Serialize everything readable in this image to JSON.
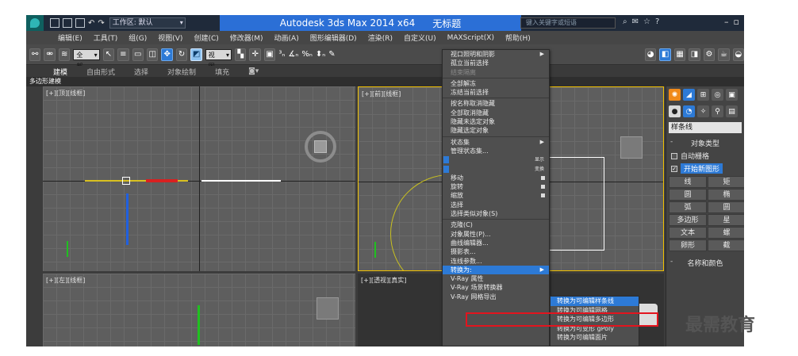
{
  "titlebar": {
    "workspace": "工作区: 默认",
    "app_title": "Autodesk 3ds Max  2014 x64",
    "doc_title": "无标题",
    "search_placeholder": "键入关键字或短语"
  },
  "menubar": [
    "编辑(E)",
    "工具(T)",
    "组(G)",
    "视图(V)",
    "创建(C)",
    "修改器(M)",
    "动画(A)",
    "图形编辑器(D)",
    "渲染(R)",
    "自定义(U)",
    "MAXScript(X)",
    "帮助(H)"
  ],
  "toolbar": {
    "selection_filter": "全部",
    "ref_coord": "视图"
  },
  "ribbon": {
    "tabs": [
      "建模",
      "自由形式",
      "选择",
      "对象绘制",
      "填充"
    ],
    "sub_label": "多边形建模"
  },
  "viewports": {
    "top_left": "[+][顶][线框]",
    "top_right": "[+][前][线框]",
    "bottom_left": "[+][左][线框]",
    "bottom_right": "[+][透视][真实]"
  },
  "quad_menu": {
    "items": [
      {
        "label": "视口照明和阴影",
        "arrow": true
      },
      {
        "label": "孤立当前选择"
      },
      {
        "label": "结束隔离",
        "disabled": true
      },
      {
        "sep": true
      },
      {
        "label": "全部解冻"
      },
      {
        "label": "冻结当前选择"
      },
      {
        "sep": true
      },
      {
        "label": "按名称取消隐藏"
      },
      {
        "label": "全部取消隐藏"
      },
      {
        "label": "隐藏未选定对象"
      },
      {
        "label": "隐藏选定对象"
      },
      {
        "sep": true
      },
      {
        "label": "状态集",
        "arrow": true
      },
      {
        "label": "管理状态集..."
      },
      {
        "label": "显示",
        "right": true
      },
      {
        "label": "变换",
        "right": true
      },
      {
        "label": "移动",
        "sq": true
      },
      {
        "label": "旋转",
        "sq": true
      },
      {
        "label": "缩放",
        "sq": true
      },
      {
        "label": "选择"
      },
      {
        "label": "选择类似对象(S)"
      },
      {
        "sep": true
      },
      {
        "label": "克隆(C)"
      },
      {
        "label": "对象属性(P)..."
      },
      {
        "label": "曲线编辑器..."
      },
      {
        "label": "摄影表..."
      },
      {
        "label": "连线参数..."
      },
      {
        "label": "转换为:",
        "arrow": true,
        "active": true
      },
      {
        "label": "V-Ray 属性"
      },
      {
        "label": "V-Ray 场景转换器"
      },
      {
        "label": "V-Ray 网格导出"
      }
    ]
  },
  "submenu": {
    "items": [
      {
        "label": "转换为可编辑样条线",
        "active": true
      },
      {
        "label": "转换为可编辑网格"
      },
      {
        "label": "转换为可编辑多边形"
      },
      {
        "label": "转换为可变形 gPoly"
      },
      {
        "label": "转换为可编辑面片"
      }
    ]
  },
  "command_panel": {
    "category": "样条线",
    "rollout_object_type": "对象类型",
    "auto_grid": "自动栅格",
    "start_new_shape": "开始新图形",
    "buttons": [
      "线",
      "矩",
      "圆",
      "椭",
      "弧",
      "圆",
      "多边形",
      "星",
      "文本",
      "螺",
      "卵形",
      "截"
    ],
    "rollout_name_color": "名称和颜色"
  },
  "watermark": "最需教育"
}
